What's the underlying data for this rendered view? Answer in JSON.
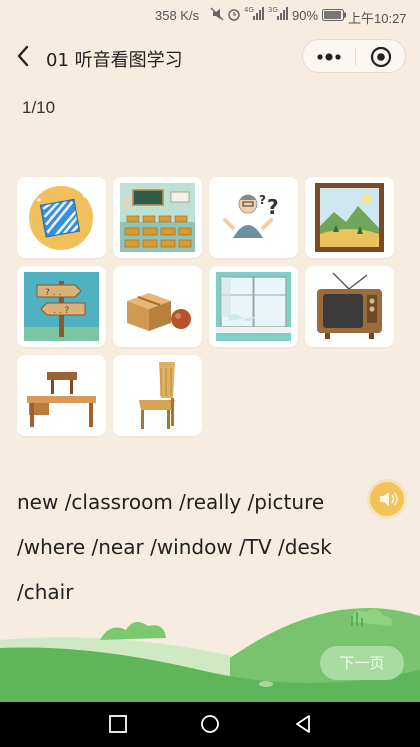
{
  "status": {
    "speed": "358 K/s",
    "signal1": "4G",
    "signal2": "3G",
    "battery": "90%",
    "time": "上午10:27"
  },
  "nav": {
    "title": "01 听音看图学习",
    "menu_icon": "more-dots-icon",
    "close_icon": "target-close-icon"
  },
  "progress": "1/10",
  "cards": [
    {
      "icon": "new-gift-box"
    },
    {
      "icon": "classroom"
    },
    {
      "icon": "really-confused-man"
    },
    {
      "icon": "picture-frame"
    },
    {
      "icon": "where-signpost"
    },
    {
      "icon": "near-box-ball"
    },
    {
      "icon": "window"
    },
    {
      "icon": "tv"
    },
    {
      "icon": "desk"
    },
    {
      "icon": "chair"
    }
  ],
  "words": {
    "line1": "new /classroom /really /picture",
    "line2": "/where /near /window /TV /desk",
    "line3": "/chair"
  },
  "sound_icon": "speaker-icon",
  "next_label": "下一页",
  "colors": {
    "background": "#f6ecdf",
    "accent_yellow": "#f3c35a",
    "next_green": "#a8dca1",
    "grass": "#5fb65a"
  }
}
